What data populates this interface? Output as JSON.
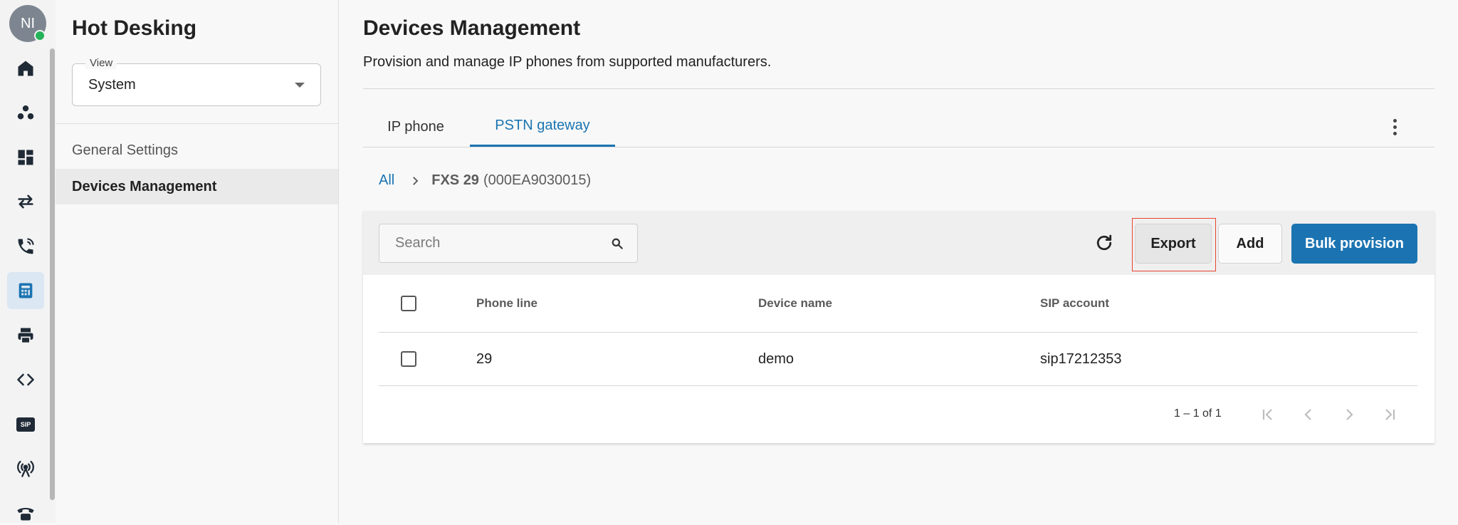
{
  "user": {
    "initials": "NI"
  },
  "rail": {
    "icons": [
      "home-icon",
      "groups-icon",
      "dashboard-icon",
      "call-transfer-icon",
      "phone-call-icon",
      "desk-phone-icon",
      "printer-icon",
      "code-icon",
      "sip-icon",
      "antenna-icon",
      "telephone-icon"
    ],
    "active": "desk-phone-icon",
    "sip_label": "SIP"
  },
  "sidebar": {
    "title": "Hot Desking",
    "view_label": "View",
    "view_value": "System",
    "items": [
      {
        "label": "General Settings"
      },
      {
        "label": "Devices Management"
      }
    ]
  },
  "main": {
    "title": "Devices Management",
    "subtitle": "Provision and manage IP phones from supported manufacturers.",
    "tabs": [
      {
        "label": "IP phone"
      },
      {
        "label": "PSTN gateway"
      }
    ],
    "active_tab": "PSTN gateway",
    "breadcrumb": {
      "root": "All",
      "device_name": "FXS 29",
      "device_id": "(000EA9030015)"
    },
    "toolbar": {
      "search_placeholder": "Search",
      "export_label": "Export",
      "add_label": "Add",
      "bulk_label": "Bulk provision"
    },
    "table": {
      "columns": [
        "Phone line",
        "Device name",
        "SIP account"
      ],
      "rows": [
        {
          "phone_line": "29",
          "device_name": "demo",
          "sip_account": "sip17212353"
        }
      ]
    },
    "pagination": {
      "text": "1 – 1 of 1"
    }
  },
  "colors": {
    "accent": "#1b74b1",
    "highlight": "#e8442c",
    "status_online": "#25b25a"
  }
}
